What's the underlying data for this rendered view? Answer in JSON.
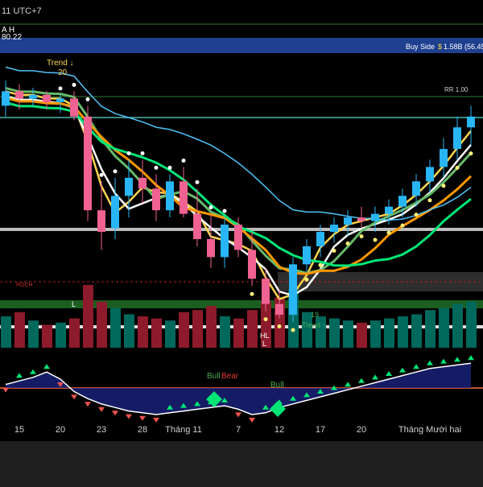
{
  "header": {
    "tz_label": "11 UTC+7",
    "top_left_marks": "A H",
    "top_left_value": "80.22"
  },
  "banner": {
    "text": "Buy Side",
    "symbol": "$",
    "value": "1.58B (56.45"
  },
  "rr_label": "RR 1.00",
  "annotations": {
    "trend_down": "Trend ↓",
    "trend_down_value": "20",
    "trend_up": "Trend ↑",
    "trend_up_value": "19",
    "hl": "HL",
    "l1": "L",
    "l2": "L",
    "roch": "ROCH",
    "bull1": "Bull",
    "bear1": "Bear",
    "bull2": "Bull"
  },
  "chart_data": {
    "type": "candlestick",
    "title": "",
    "xlabel": "",
    "ylabel": "",
    "x_ticks": [
      "15",
      "20",
      "23",
      "28",
      "Tháng 11",
      "7",
      "12",
      "17",
      "20",
      "Tháng Mười hai"
    ],
    "candles": [
      {
        "o": 75,
        "h": 82,
        "l": 72,
        "c": 79
      },
      {
        "o": 79,
        "h": 81,
        "l": 74,
        "c": 77
      },
      {
        "o": 77,
        "h": 80,
        "l": 75,
        "c": 78
      },
      {
        "o": 78,
        "h": 79,
        "l": 74,
        "c": 76
      },
      {
        "o": 76,
        "h": 78,
        "l": 73,
        "c": 77
      },
      {
        "o": 77,
        "h": 79,
        "l": 71,
        "c": 72
      },
      {
        "o": 72,
        "h": 75,
        "l": 43,
        "c": 46
      },
      {
        "o": 46,
        "h": 54,
        "l": 35,
        "c": 40
      },
      {
        "o": 41,
        "h": 55,
        "l": 38,
        "c": 50
      },
      {
        "o": 50,
        "h": 60,
        "l": 44,
        "c": 55
      },
      {
        "o": 55,
        "h": 60,
        "l": 48,
        "c": 52
      },
      {
        "o": 52,
        "h": 56,
        "l": 43,
        "c": 46
      },
      {
        "o": 46,
        "h": 56,
        "l": 44,
        "c": 54
      },
      {
        "o": 54,
        "h": 58,
        "l": 44,
        "c": 45
      },
      {
        "o": 45,
        "h": 52,
        "l": 36,
        "c": 38
      },
      {
        "o": 38,
        "h": 45,
        "l": 30,
        "c": 33
      },
      {
        "o": 33,
        "h": 44,
        "l": 30,
        "c": 42
      },
      {
        "o": 42,
        "h": 44,
        "l": 33,
        "c": 35
      },
      {
        "o": 35,
        "h": 40,
        "l": 25,
        "c": 27
      },
      {
        "o": 27,
        "h": 30,
        "l": 18,
        "c": 20
      },
      {
        "o": 20,
        "h": 24,
        "l": 16,
        "c": 17
      },
      {
        "o": 17,
        "h": 33,
        "l": 15,
        "c": 31
      },
      {
        "o": 31,
        "h": 38,
        "l": 29,
        "c": 36
      },
      {
        "o": 36,
        "h": 42,
        "l": 33,
        "c": 40
      },
      {
        "o": 40,
        "h": 44,
        "l": 37,
        "c": 42
      },
      {
        "o": 42,
        "h": 46,
        "l": 39,
        "c": 44
      },
      {
        "o": 44,
        "h": 47,
        "l": 41,
        "c": 43
      },
      {
        "o": 43,
        "h": 47,
        "l": 40,
        "c": 45
      },
      {
        "o": 45,
        "h": 49,
        "l": 42,
        "c": 47
      },
      {
        "o": 47,
        "h": 52,
        "l": 44,
        "c": 50
      },
      {
        "o": 50,
        "h": 56,
        "l": 47,
        "c": 54
      },
      {
        "o": 54,
        "h": 60,
        "l": 51,
        "c": 58
      },
      {
        "o": 58,
        "h": 66,
        "l": 55,
        "c": 63
      },
      {
        "o": 63,
        "h": 72,
        "l": 60,
        "c": 69
      },
      {
        "o": 69,
        "h": 75,
        "l": 64,
        "c": 72
      }
    ],
    "volume": [
      30,
      34,
      26,
      22,
      24,
      28,
      60,
      44,
      38,
      32,
      30,
      28,
      26,
      34,
      36,
      40,
      30,
      28,
      36,
      44,
      48,
      56,
      34,
      30,
      28,
      26,
      24,
      26,
      28,
      30,
      32,
      36,
      38,
      42,
      44
    ],
    "oscillator": [
      0.2,
      0.4,
      0.6,
      0.9,
      0.5,
      -0.2,
      -0.6,
      -0.9,
      -1.1,
      -1.3,
      -1.4,
      -1.5,
      -1.4,
      -1.3,
      -1.2,
      -1.1,
      -1.0,
      -1.2,
      -1.5,
      -1.4,
      -1.1,
      -0.9,
      -0.7,
      -0.5,
      -0.3,
      -0.1,
      0.1,
      0.3,
      0.5,
      0.7,
      0.9,
      1.1,
      1.2,
      1.3,
      1.4
    ],
    "colors": {
      "up": "#26a69a",
      "up_bright": "#29b6f6",
      "down": "#f06292",
      "bg": "#000000",
      "band": "#2b67c6"
    }
  }
}
